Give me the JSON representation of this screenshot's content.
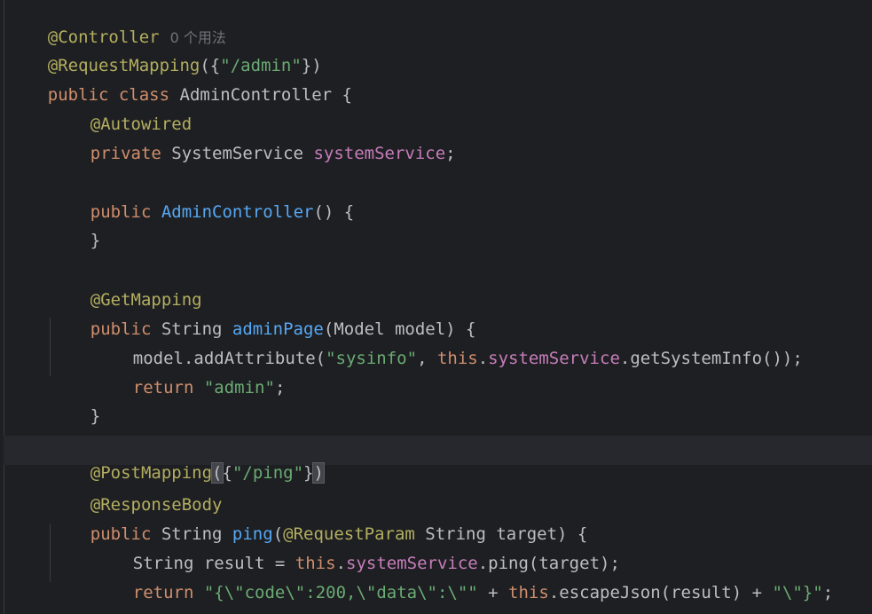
{
  "editor": {
    "colors": {
      "background": "#1e1f22",
      "annotation": "#b3ae60",
      "keyword": "#cf8e6d",
      "string": "#6aab73",
      "field": "#c77dbb",
      "method": "#56a8f5",
      "text": "#bcbec4",
      "hint": "#6f737a"
    },
    "usage_hint": "0 个用法",
    "lines": [
      [
        "@Controller"
      ],
      [
        "@RequestMapping",
        "({",
        "\"/admin\"",
        "})"
      ],
      [
        "public",
        " ",
        "class",
        " AdminController {"
      ],
      [
        "@Autowired"
      ],
      [
        "private",
        " SystemService ",
        "systemService",
        ";"
      ],
      [],
      [
        "public",
        " ",
        "AdminController",
        "() {"
      ],
      [
        "}"
      ],
      [],
      [
        "@GetMapping"
      ],
      [
        "public",
        " String ",
        "adminPage",
        "(Model model) {"
      ],
      [
        "model.addAttribute(",
        "\"sysinfo\"",
        ", ",
        "this",
        ".",
        "systemService",
        ".getSystemInfo());"
      ],
      [
        "return",
        " ",
        "\"admin\"",
        ";"
      ],
      [
        "}"
      ],
      [],
      [
        "@PostMapping",
        "(",
        "{",
        "\"/ping\"",
        "}",
        ")"
      ],
      [
        "@ResponseBody"
      ],
      [
        "public",
        " String ",
        "ping",
        "(",
        "@RequestParam",
        " String target) {"
      ],
      [
        "String result = ",
        "this",
        ".",
        "systemService",
        ".ping(target);"
      ],
      [
        "return",
        " ",
        "\"{\\\"code\\\":200,\\\"data\\\":\\\"\"",
        " + ",
        "this",
        ".escapeJson(result) + ",
        "\"\\\"}\"",
        ";"
      ],
      [
        "}"
      ]
    ]
  }
}
